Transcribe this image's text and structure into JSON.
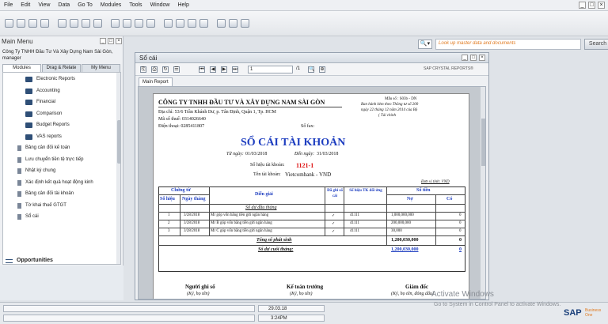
{
  "menu": [
    "File",
    "Edit",
    "View",
    "Data",
    "Go To",
    "Modules",
    "Tools",
    "Window",
    "Help"
  ],
  "search": {
    "placeholder": "Look up master data and documents",
    "button": "Search"
  },
  "mainmenu": {
    "title": "Main Menu",
    "company": "Công Ty TNHH Đầu Tư Và Xây Dựng Nam Sài Gòn,",
    "user": "manager",
    "tabs": [
      "Modules",
      "Drag & Relate",
      "My Menu"
    ],
    "items": [
      {
        "label": "Electronic Reports",
        "type": "folder"
      },
      {
        "label": "Accounting",
        "type": "folder"
      },
      {
        "label": "Financial",
        "type": "folder"
      },
      {
        "label": "Comparison",
        "type": "folder"
      },
      {
        "label": "Budget Reports",
        "type": "folder"
      },
      {
        "label": "VAS reports",
        "type": "folder"
      },
      {
        "label": "Bảng cân đối kế toán",
        "type": "doc"
      },
      {
        "label": "Lưu chuyển tiền tệ trực tiếp",
        "type": "doc"
      },
      {
        "label": "Nhật ký chung",
        "type": "doc"
      },
      {
        "label": "Xác định kết quả hoạt động kinh",
        "type": "doc"
      },
      {
        "label": "Bảng cân đối tài khoản",
        "type": "doc"
      },
      {
        "label": "Tờ khai thuế GTGT",
        "type": "doc"
      },
      {
        "label": "Sổ cái",
        "type": "doc"
      }
    ],
    "opportunities": "Opportunities"
  },
  "docwin": {
    "title": "Sổ cái",
    "page": "1",
    "page_count": "/1",
    "crystal": "SAP CRYSTAL REPORTS®",
    "tab": "Main Report"
  },
  "report": {
    "company": "CÔNG TY TNHH ĐẦU TƯ VÀ XÂY DỰNG NAM SÀI GÒN",
    "address": "Địa chỉ: 53/6 Trần Khánh Dư, p. Tân Định, Quận 1, Tp. HCM",
    "tax": "Mã số thuế: 0314026640",
    "phone": "Điện thoại: 0285411807",
    "fax": "Số fax:",
    "form_no": "Mẫu số : S03b - DN",
    "form_note1": "Ban hành kèm theo Thông tư số 200",
    "form_note2": "ngày 22 tháng 12 năm 2014 của Bộ",
    "form_note3": "( Tài chính",
    "main_title": "SỔ CÁI TÀI KHOẢN",
    "from_label": "Từ ngày:",
    "from_date": "01/03/2018",
    "to_label": "Đến ngày:",
    "to_date": "31/03/2018",
    "acct_no_label": "Số hiệu tài khoản:",
    "acct_no": "1121-1",
    "acct_name_label": "Tên tài khoản:",
    "acct_name": "Vietcombank - VND",
    "currency": "Đơn vị tính: VND",
    "headers": {
      "voucher": "Chứng từ",
      "no": "Số hiệu",
      "date": "Ngày tháng",
      "desc": "Diễn giải",
      "posted": "Đã ghi sổ cái",
      "contra": "Số hiệu TK đối ứng",
      "amount": "Số tiền",
      "debit": "Nợ",
      "credit": "Có"
    },
    "opening": "Số dư đầu tháng",
    "rows": [
      {
        "no": "1",
        "date": "3/28/2018",
        "desc": "Mr góp vốn bằng tiền gửi ngân hàng",
        "posted": "✓",
        "contra": "41111",
        "debit": "1,000,000,000",
        "credit": "0"
      },
      {
        "no": "2",
        "date": "3/28/2018",
        "desc": "Mr B góp vốn bằng tiền gửi ngân hàng",
        "posted": "✓",
        "contra": "41111",
        "debit": "200,000,000",
        "credit": "0"
      },
      {
        "no": "3",
        "date": "3/28/2018",
        "desc": "Mr C góp vốn bằng tiền gửi ngân hàng",
        "posted": "✓",
        "contra": "41111",
        "debit": "30,000",
        "credit": "0"
      }
    ],
    "total_label": "Tổng số phát sinh",
    "total_debit": "1,200,030,000",
    "total_credit": "0",
    "closing_label": "Số dư cuối tháng:",
    "closing_debit": "1,200,030,000",
    "closing_credit": "0",
    "sign1": "Người ghi sổ",
    "sign1b": "(Ký, họ tên)",
    "sign2": "Kế toán trưởng",
    "sign2b": "(Ký, họ tên)",
    "sign3": "Giám đốc",
    "sign3b": "(Ký, họ tên, đóng dấu)"
  },
  "status": {
    "date": "29.03.18",
    "time": "3:24PM"
  },
  "watermark": {
    "line1": "Activate Windows",
    "line2": "Go to System in Control Panel to activate Windows."
  },
  "brand": {
    "sap": "SAP",
    "b1": "Business One"
  }
}
